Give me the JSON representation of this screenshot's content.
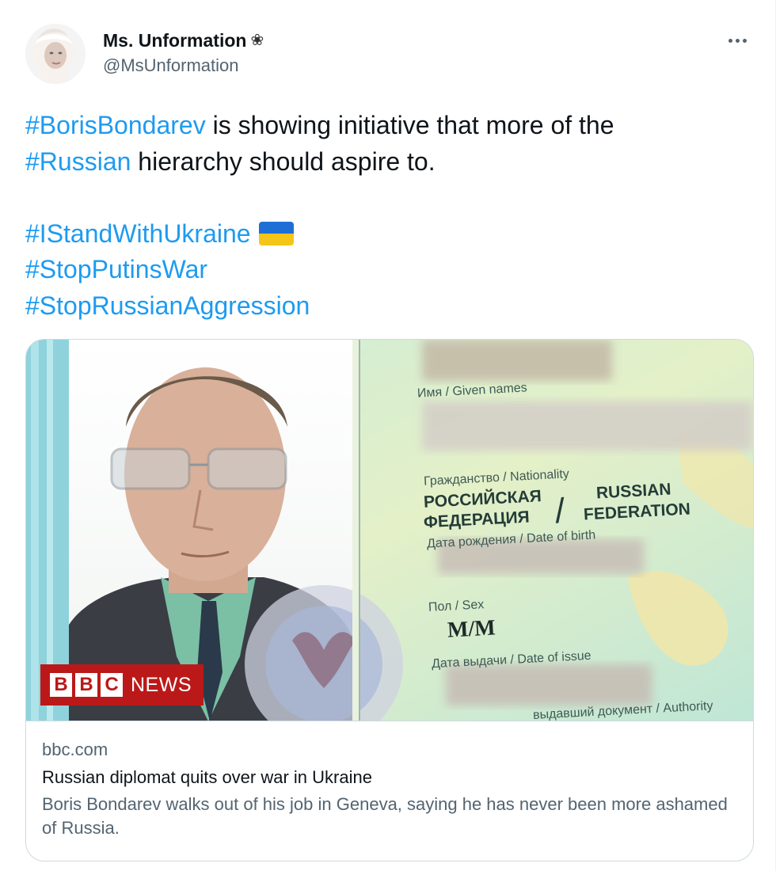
{
  "user": {
    "display_name": "Ms. Unformation",
    "name_emoji": "❀",
    "handle": "@MsUnformation"
  },
  "tweet": {
    "line1_tag": "#BorisBondarev",
    "line1_rest": " is showing initiative that more of the",
    "line2_tag": "#Russian",
    "line2_rest": " hierarchy should aspire to.",
    "tag_stand": "#IStandWithUkraine",
    "flag_icon": "ukraine-flag-icon",
    "tag_stop_putin": "#StopPutinsWar",
    "tag_stop_aggression": "#StopRussianAggression"
  },
  "card": {
    "image": {
      "given_names_label": "Имя / Given names",
      "nationality_label": "Гражданство / Nationality",
      "nationality_ru_1": "РОССИЙСКАЯ",
      "nationality_ru_2": "ФЕДЕРАЦИЯ",
      "nationality_slash": "/",
      "nationality_en_1": "RUSSIAN",
      "nationality_en_2": "FEDERATION",
      "dob_label": "Дата рождения / Date of birth",
      "sex_label": "Пол / Sex",
      "sex_value": "М/M",
      "issue_label": "Дата выдачи / Date of issue",
      "authority_label": "выдавший документ / Authority"
    },
    "logo": {
      "letters": [
        "B",
        "B",
        "C"
      ],
      "news": "NEWS"
    },
    "domain": "bbc.com",
    "title": "Russian diplomat quits over war in Ukraine",
    "description": "Boris Bondarev walks out of his job in Geneva, saying he has never been more ashamed of Russia."
  },
  "colors": {
    "link": "#1d9bf0",
    "text": "#0f1419",
    "secondary": "#536471",
    "bbc_red": "#bb1919",
    "border": "#cfd9de"
  }
}
